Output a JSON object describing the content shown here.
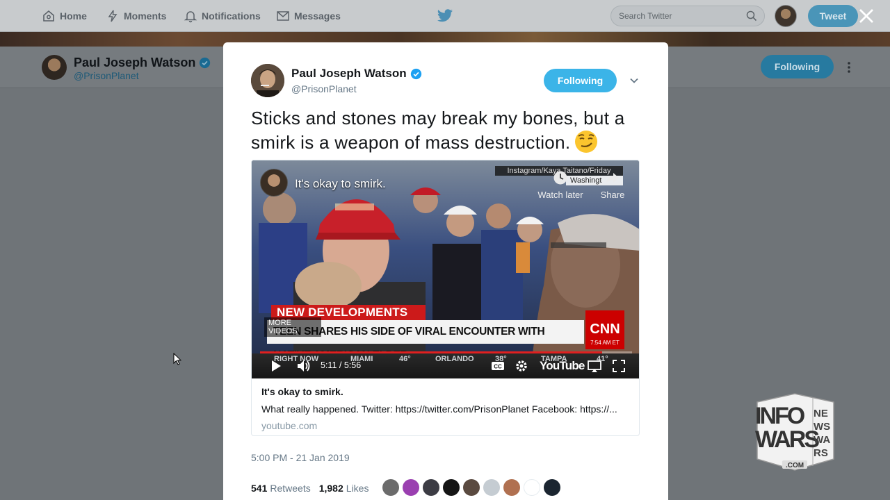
{
  "nav": {
    "home": "Home",
    "moments": "Moments",
    "notifications": "Notifications",
    "messages": "Messages",
    "search_placeholder": "Search Twitter",
    "tweet_button": "Tweet"
  },
  "profile": {
    "name": "Paul Joseph Watson",
    "handle": "@PrisonPlanet",
    "follow_state": "Following"
  },
  "tweet": {
    "author_name": "Paul Joseph Watson",
    "author_handle": "@PrisonPlanet",
    "follow_state": "Following",
    "text": "Sticks and stones may break my bones, but a smirk is a weapon of mass destruction.",
    "emoji": "smirking-face",
    "timestamp": "5:00 PM - 21 Jan 2019",
    "retweets": "541",
    "retweets_label": "Retweets",
    "likes": "1,982",
    "likes_label": "Likes"
  },
  "video": {
    "title": "It's okay to smirk.",
    "watch_later": "Watch later",
    "share": "Share",
    "credit": "Instagram/Kaya Taitano/Friday",
    "credit2": "Washingt",
    "headline_tag": "NEW DEVELOPMENTS",
    "headline": "TEEN SHARES HIS SIDE OF VIRAL ENCOUNTER WITH NATIVE AMERICAN ELDER",
    "network": "CNN",
    "network_time": "7:54 AM ET",
    "more_videos": "MORE VIDEOS",
    "ticker": [
      "RIGHT NOW",
      "MIAMI",
      "46°",
      "ORLANDO",
      "38°",
      "TAMPA",
      "41°"
    ],
    "time_display": "5:11 / 5:56",
    "progress": 0.92,
    "youtube": "YouTube"
  },
  "card": {
    "title": "It's okay to smirk.",
    "description": "What really happened. Twitter: https://twitter.com/PrisonPlanet Facebook: https://...",
    "domain": "youtube.com"
  },
  "watermark": {
    "line1": "INFO",
    "line2": "WARS",
    "side": "NEWS WARS",
    "suffix": ".COM"
  },
  "colors": {
    "twitter_blue": "#1da1f2",
    "follow_button": "#3bb4e8",
    "cnn_red": "#cc0000",
    "verified": "#1da1f2"
  }
}
